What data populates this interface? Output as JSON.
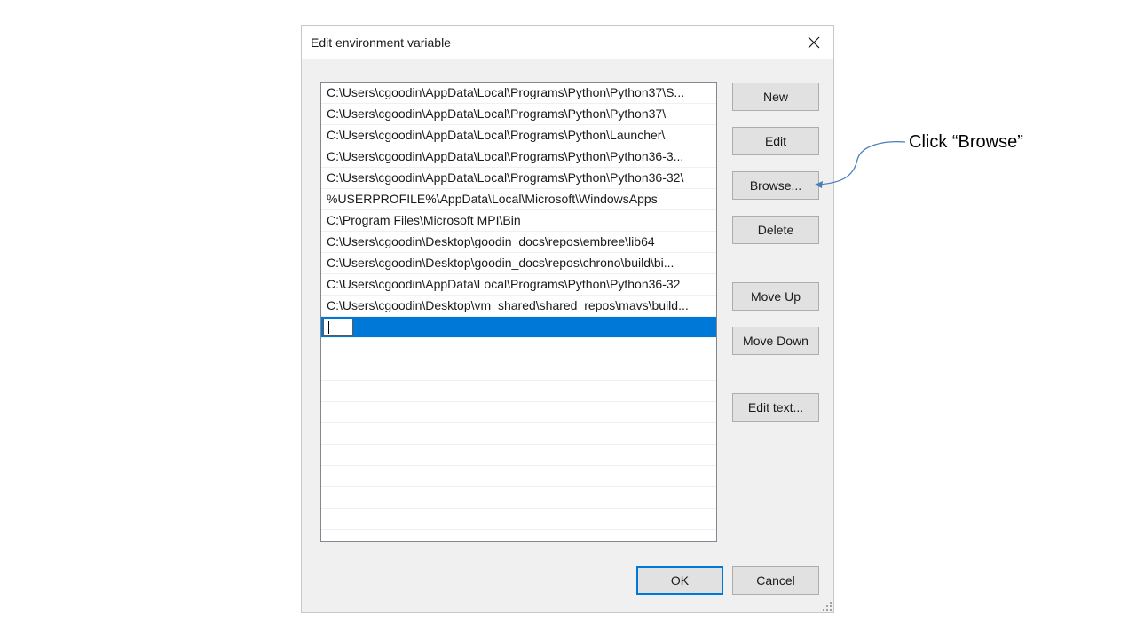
{
  "dialog": {
    "title": "Edit environment variable",
    "close_icon": "close-icon"
  },
  "list": {
    "items": [
      "C:\\Users\\cgoodin\\AppData\\Local\\Programs\\Python\\Python37\\S...",
      "C:\\Users\\cgoodin\\AppData\\Local\\Programs\\Python\\Python37\\",
      "C:\\Users\\cgoodin\\AppData\\Local\\Programs\\Python\\Launcher\\",
      "C:\\Users\\cgoodin\\AppData\\Local\\Programs\\Python\\Python36-3...",
      "C:\\Users\\cgoodin\\AppData\\Local\\Programs\\Python\\Python36-32\\",
      "%USERPROFILE%\\AppData\\Local\\Microsoft\\WindowsApps",
      "C:\\Program Files\\Microsoft MPI\\Bin",
      "C:\\Users\\cgoodin\\Desktop\\goodin_docs\\repos\\embree\\lib64",
      "C:\\Users\\cgoodin\\Desktop\\goodin_docs\\repos\\chrono\\build\\bi...",
      "C:\\Users\\cgoodin\\AppData\\Local\\Programs\\Python\\Python36-32",
      "C:\\Users\\cgoodin\\Desktop\\vm_shared\\shared_repos\\mavs\\build..."
    ],
    "new_entry_value": ""
  },
  "buttons": {
    "new": "New",
    "edit": "Edit",
    "browse": "Browse...",
    "delete": "Delete",
    "move_up": "Move Up",
    "move_down": "Move Down",
    "edit_text": "Edit text...",
    "ok": "OK",
    "cancel": "Cancel"
  },
  "annotation": {
    "text": "Click “Browse”"
  },
  "colors": {
    "selection": "#0078d7",
    "dialog_bg": "#f0f0f0",
    "annotation_arrow": "#4a7ebb"
  }
}
